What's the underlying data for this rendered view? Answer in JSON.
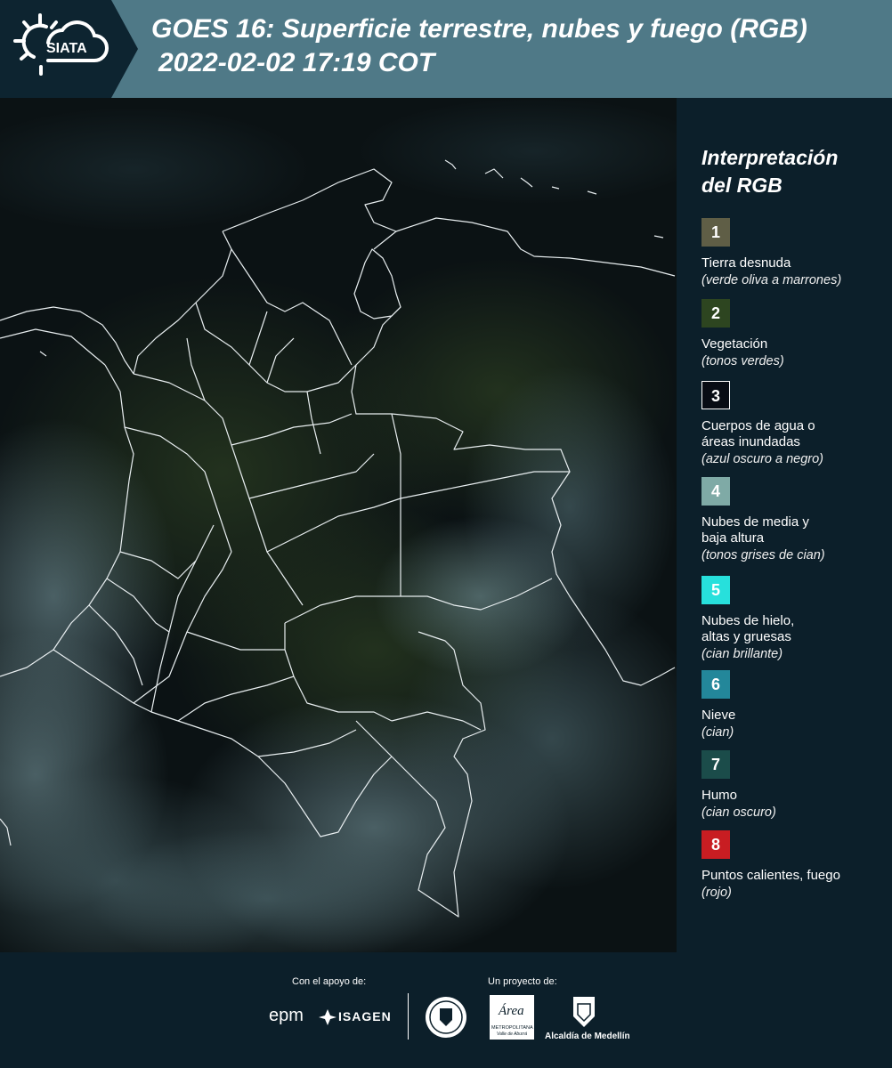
{
  "header": {
    "logo_text": "SIATA",
    "title_line1": "GOES 16: Superficie terrestre, nubes y fuego (RGB)",
    "title_line2": "2022-02-02 17:19 COT"
  },
  "legend": {
    "title_line1": "Interpretación",
    "title_line2": "del RGB",
    "items": [
      {
        "number": "1",
        "color": "#5f5e46",
        "label_lines": [
          "Tierra desnuda"
        ],
        "sub": "(verde oliva a marrones)"
      },
      {
        "number": "2",
        "color": "#2d4520",
        "label_lines": [
          "Vegetación"
        ],
        "sub": "(tonos verdes)"
      },
      {
        "number": "3",
        "color": "#080c14",
        "label_lines": [
          "Cuerpos de agua o",
          "áreas inundadas"
        ],
        "sub": "(azul oscuro a negro)"
      },
      {
        "number": "4",
        "color": "#7faaa6",
        "label_lines": [
          "Nubes de media y",
          "baja altura"
        ],
        "sub": "(tonos grises de cian)"
      },
      {
        "number": "5",
        "color": "#27e0dc",
        "label_lines": [
          "Nubes de hielo,",
          "altas y gruesas"
        ],
        "sub": "(cian brillante)"
      },
      {
        "number": "6",
        "color": "#23879a",
        "label_lines": [
          "Nieve"
        ],
        "sub": "(cian)"
      },
      {
        "number": "7",
        "color": "#1b4c4a",
        "label_lines": [
          "Humo"
        ],
        "sub": "(cian oscuro)"
      },
      {
        "number": "8",
        "color": "#c81d22",
        "label_lines": [
          "Puntos calientes, fuego"
        ],
        "sub": "(rojo)"
      }
    ]
  },
  "footer": {
    "support_label": "Con el apoyo de:",
    "project_label": "Un proyecto de:",
    "epm_logo": "epm",
    "isagen_logo": "ISAGEN",
    "area_logo_word": "Área",
    "area_logo_line1": "METROPOLITANA",
    "area_logo_line2": "Valle de Aburrá",
    "alcaldia_label": "Alcaldía de Medellín"
  },
  "colors": {
    "header_left": "#0d2430",
    "header_band": "#4f7987",
    "background": "#0c1f2a",
    "border_lines": "#e8eef0"
  }
}
